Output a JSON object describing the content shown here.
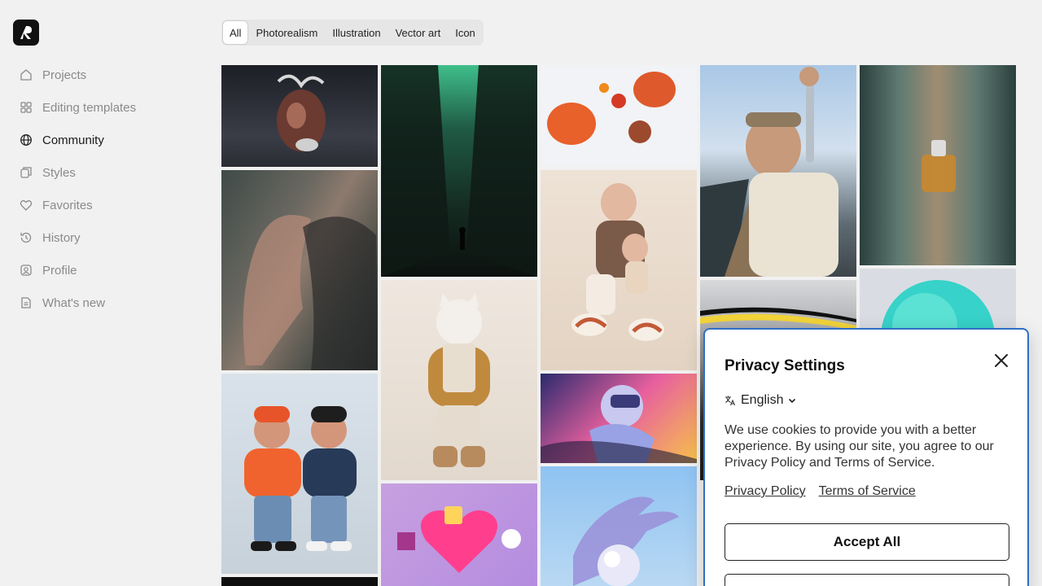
{
  "nav": {
    "items": [
      {
        "label": "Projects",
        "icon": "home-icon"
      },
      {
        "label": "Editing templates",
        "icon": "grid-icon"
      },
      {
        "label": "Community",
        "icon": "globe-icon",
        "active": true
      },
      {
        "label": "Styles",
        "icon": "styles-icon"
      },
      {
        "label": "Favorites",
        "icon": "heart-icon"
      },
      {
        "label": "History",
        "icon": "history-icon"
      },
      {
        "label": "Profile",
        "icon": "profile-icon"
      },
      {
        "label": "What's new",
        "icon": "document-icon"
      }
    ]
  },
  "filters": {
    "chips": [
      "All",
      "Photorealism",
      "Illustration",
      "Vector art",
      "Icon"
    ],
    "selected": "All"
  },
  "gallery": {
    "tiles": [
      {
        "subject": "chrome anatomical heart"
      },
      {
        "subject": "motion blur portrait"
      },
      {
        "subject": "two figurines in sweaters"
      },
      {
        "subject": "green skyscrapers with figure"
      },
      {
        "subject": "plush cat figurine"
      },
      {
        "subject": "3d heart character"
      },
      {
        "subject": "tomatoes and peppers"
      },
      {
        "subject": "clay figures sitting"
      },
      {
        "subject": "anime mecha illustration"
      },
      {
        "subject": "hand with glass sphere"
      },
      {
        "subject": "fisherman holding fish"
      },
      {
        "subject": "striped stacked object"
      },
      {
        "subject": "blurred perfume bottle"
      },
      {
        "subject": "teal glowing sphere"
      }
    ]
  },
  "privacy": {
    "title": "Privacy Settings",
    "language": "English",
    "body": "We use cookies to provide you with a better experience. By using our site, you agree to our Privacy Policy and Terms of Service.",
    "privacy_link": "Privacy Policy",
    "terms_link": "Terms of Service",
    "accept_label": "Accept All",
    "border_color": "#2f6fc4"
  }
}
